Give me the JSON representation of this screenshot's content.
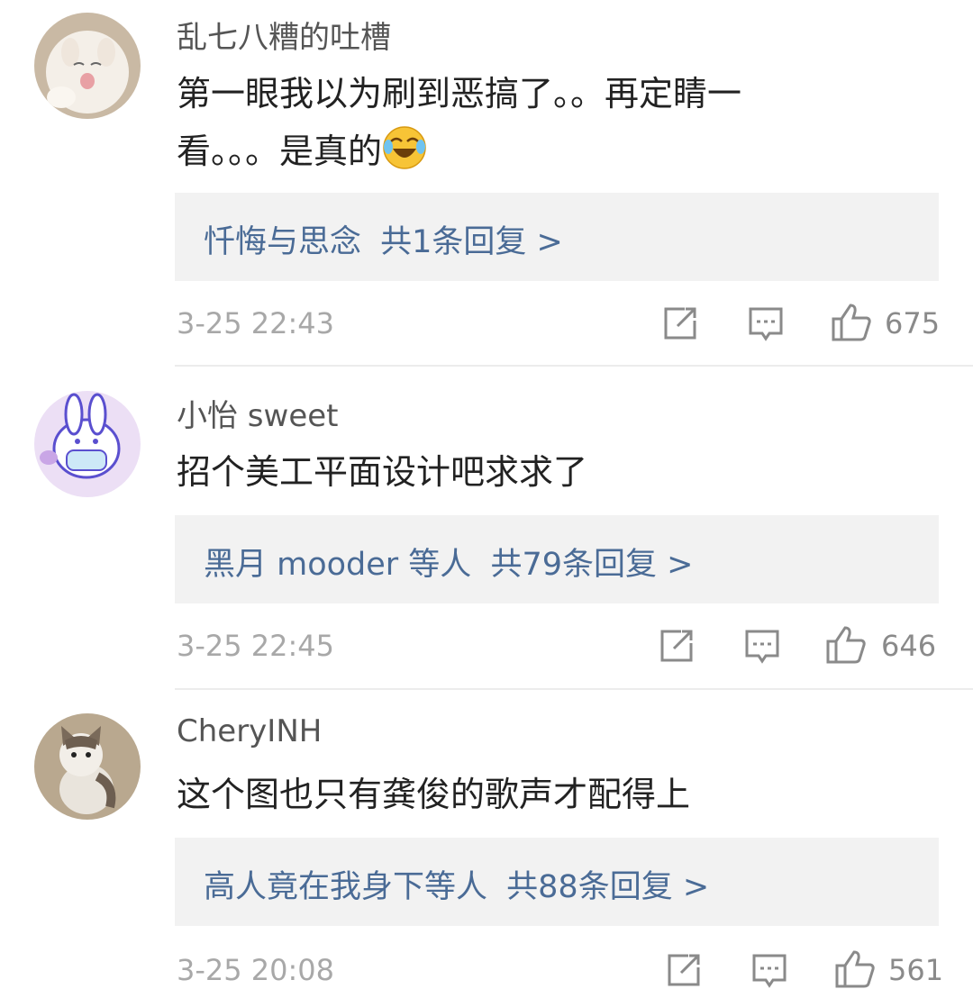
{
  "comments": [
    {
      "username": "乱七八糟的吐槽",
      "text_line1": "第一眼我以为刷到恶搞了。。再定睛一",
      "text_line2": "看。。。是真的",
      "emoji": "laughing-crying-emoji",
      "reply_name": "忏悔与思念",
      "reply_summary": "共1条回复 >",
      "timestamp": "3-25 22:43",
      "likes": "675",
      "avatar": "white-cat-avatar"
    },
    {
      "username": "小怡 sweet",
      "text_line1": "招个美工平面设计吧求求了",
      "reply_name": "黑月 mooder 等人",
      "reply_summary": "共79条回复 >",
      "timestamp": "3-25 22:45",
      "likes": "646",
      "avatar": "bunny-mask-avatar"
    },
    {
      "username": "CheryINH",
      "text_line1": "这个图也只有龚俊的歌声才配得上",
      "reply_name": "高人竟在我身下等人",
      "reply_summary": "共88条回复 >",
      "timestamp": "3-25 20:08",
      "likes": "561",
      "avatar": "tabby-cat-avatar"
    }
  ],
  "colors": {
    "link": "#4a6b96",
    "meta": "#a8a8a8",
    "reply_bg": "#f2f2f2"
  }
}
